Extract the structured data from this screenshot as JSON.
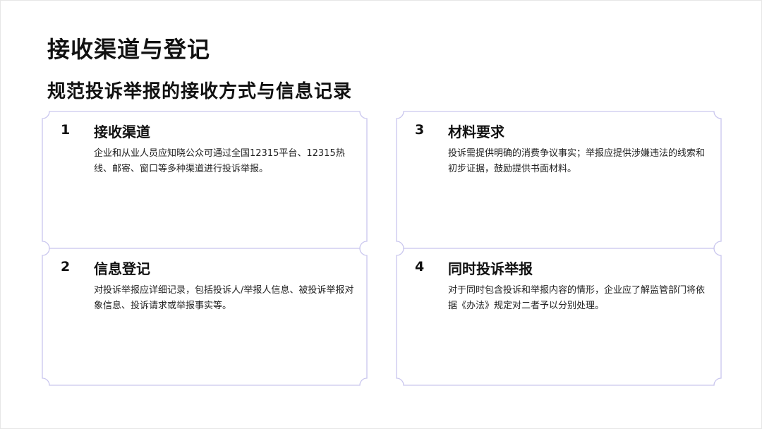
{
  "title": "接收渠道与登记",
  "subtitle": "规范投诉举报的接收方式与信息记录",
  "cards": [
    {
      "number": "1",
      "heading": "接收渠道",
      "body": "企业和从业人员应知晓公众可通过全国12315平台、12315热线、邮寄、窗口等多种渠道进行投诉举报。"
    },
    {
      "number": "3",
      "heading": "材料要求",
      "body": "投诉需提供明确的消费争议事实；举报应提供涉嫌违法的线索和初步证据，鼓励提供书面材料。"
    },
    {
      "number": "2",
      "heading": "信息登记",
      "body": "对投诉举报应详细记录，包括投诉人/举报人信息、被投诉举报对象信息、投诉请求或举报事实等。"
    },
    {
      "number": "4",
      "heading": "同时投诉举报",
      "body": "对于同时包含投诉和举报内容的情形，企业应了解监管部门将依据《办法》规定对二者予以分别处理。"
    }
  ],
  "colors": {
    "card_border": "#c9c6ee",
    "text": "#111111"
  }
}
